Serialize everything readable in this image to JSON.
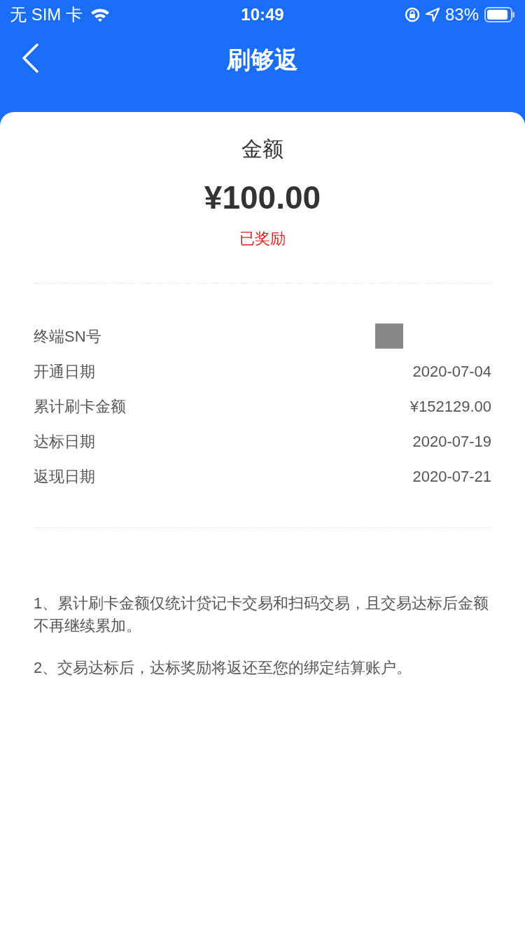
{
  "status_bar": {
    "carrier": "无 SIM 卡",
    "time": "10:49",
    "battery": "83%"
  },
  "nav": {
    "title": "刷够返"
  },
  "reward": {
    "label": "金额",
    "amount": "¥100.00",
    "status": "已奖励"
  },
  "details": [
    {
      "label": "终端SN号",
      "kind": "redacted"
    },
    {
      "label": "开通日期",
      "kind": "text",
      "value": "2020-07-04"
    },
    {
      "label": "累计刷卡金额",
      "kind": "text",
      "value": "¥152129.00"
    },
    {
      "label": "达标日期",
      "kind": "text",
      "value": "2020-07-19"
    },
    {
      "label": "返现日期",
      "kind": "text",
      "value": "2020-07-21"
    }
  ],
  "notes": [
    "1、累计刷卡金额仅统计贷记卡交易和扫码交易，且交易达标后金额不再继续累加。",
    "2、交易达标后，达标奖励将返还至您的绑定结算账户。"
  ]
}
